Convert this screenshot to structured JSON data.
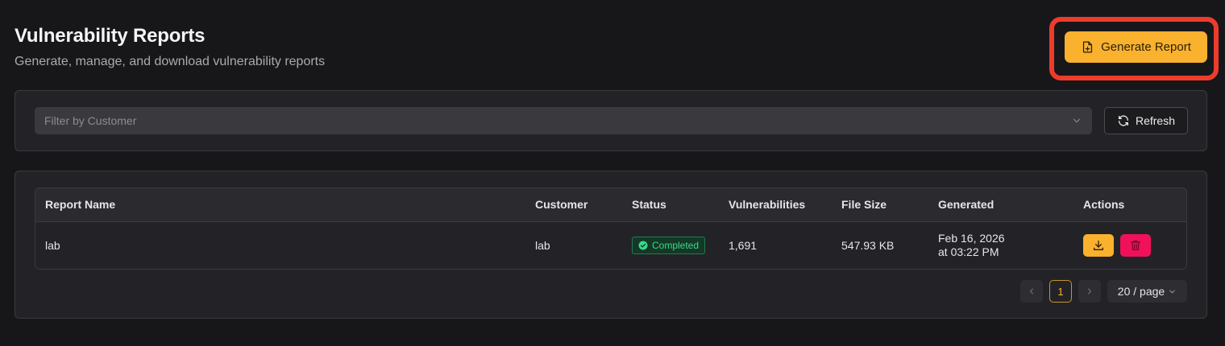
{
  "header": {
    "title": "Vulnerability Reports",
    "subtitle": "Generate, manage, and download vulnerability reports",
    "generate_label": "Generate Report"
  },
  "filter": {
    "placeholder": "Filter by Customer",
    "refresh_label": "Refresh"
  },
  "table": {
    "columns": [
      "Report Name",
      "Customer",
      "Status",
      "Vulnerabilities",
      "File Size",
      "Generated",
      "Actions"
    ],
    "rows": [
      {
        "name": "lab",
        "customer": "lab",
        "status": "Completed",
        "vulnerabilities": "1,691",
        "file_size": "547.93 KB",
        "generated_date": "Feb 16, 2026",
        "generated_time": "at 03:22 PM"
      }
    ]
  },
  "pagination": {
    "current_page": "1",
    "page_size": "20 / page"
  },
  "icons": {
    "generate": "file-plus-icon",
    "chevron": "chevron-down-icon",
    "refresh": "refresh-icon",
    "status": "check-circle-icon",
    "download": "download-icon",
    "delete": "trash-icon"
  },
  "colors": {
    "accent": "#f9b12e",
    "danger": "#f0115a",
    "success": "#39d98a",
    "highlight": "#ee3b2b",
    "background": "#17171a"
  }
}
